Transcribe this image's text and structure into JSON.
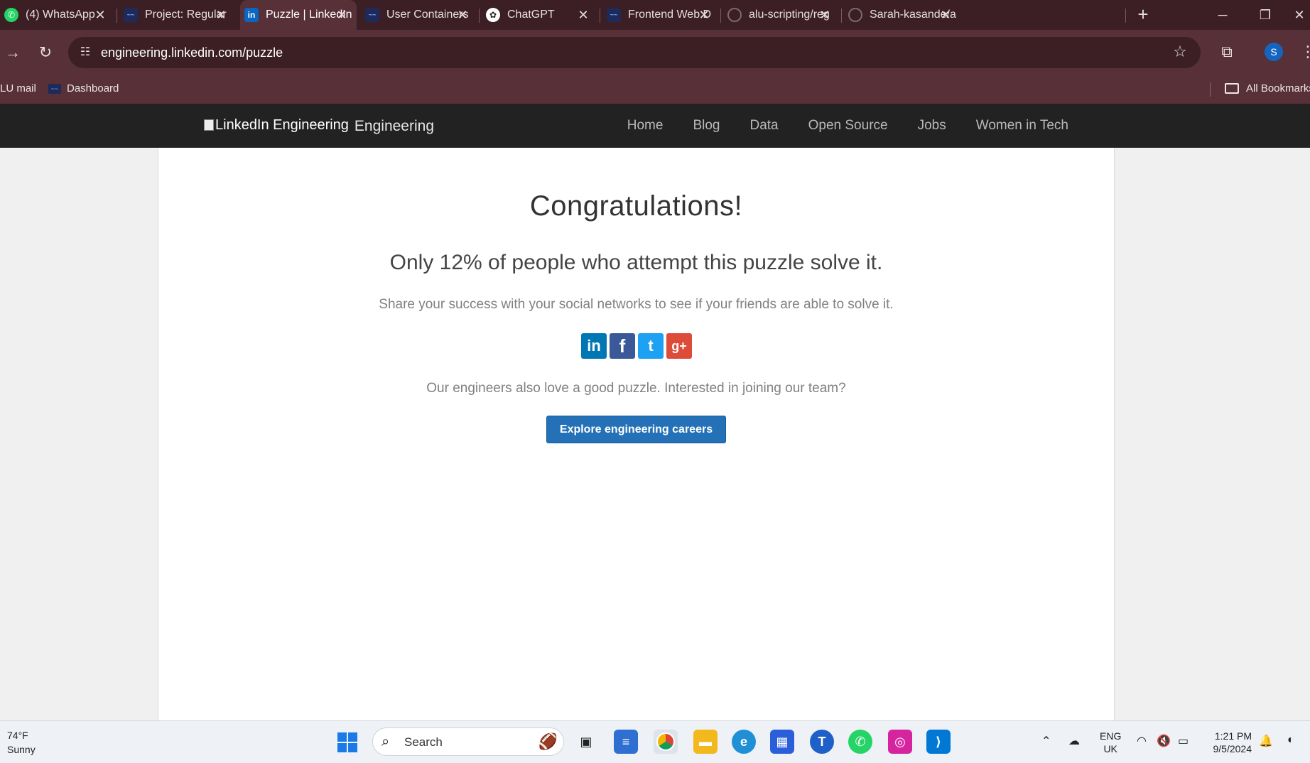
{
  "browser": {
    "tabs": [
      {
        "title": "(4) WhatsApp",
        "icon": "whatsapp-icon",
        "active": false
      },
      {
        "title": "Project: Regular",
        "icon": "alu-icon",
        "active": false
      },
      {
        "title": "Puzzle | LinkedIn",
        "icon": "linkedin-icon",
        "active": true
      },
      {
        "title": "User Containers",
        "icon": "alu-icon",
        "active": false
      },
      {
        "title": "ChatGPT",
        "icon": "chatgpt-icon",
        "active": false
      },
      {
        "title": "Frontend Web D",
        "icon": "alu-icon",
        "active": false
      },
      {
        "title": "alu-scripting/reg",
        "icon": "github-icon",
        "active": false
      },
      {
        "title": "Sarah-kasande/a",
        "icon": "github-icon",
        "active": false
      }
    ],
    "url": "engineering.linkedin.com/puzzle",
    "profile_initial": "S",
    "bookmarks": [
      {
        "label": "LU mail"
      },
      {
        "label": "Dashboard"
      }
    ],
    "all_bookmarks_label": "All Bookmarks"
  },
  "site": {
    "logo_alt": "LinkedIn Engineering",
    "logo_suffix": "Engineering",
    "nav": [
      "Home",
      "Blog",
      "Data",
      "Open Source",
      "Jobs",
      "Women in Tech"
    ]
  },
  "puzzle": {
    "heading": "Congratulations!",
    "stat": "Only 12% of people who attempt this puzzle solve it.",
    "share_text": "Share your success with your social networks to see if your friends are able to solve it.",
    "social": [
      {
        "name": "linkedin",
        "glyph": "in"
      },
      {
        "name": "facebook",
        "glyph": "f"
      },
      {
        "name": "twitter",
        "glyph": "t"
      },
      {
        "name": "google-plus",
        "glyph": "g+"
      }
    ],
    "join_text": "Our engineers also love a good puzzle. Interested in joining our team?",
    "cta_label": "Explore engineering careers"
  },
  "taskbar": {
    "weather_temp": "74°F",
    "weather_desc": "Sunny",
    "search_label": "Search",
    "lang_line1": "ENG",
    "lang_line2": "UK",
    "time": "1:21 PM",
    "date": "9/5/2024"
  }
}
